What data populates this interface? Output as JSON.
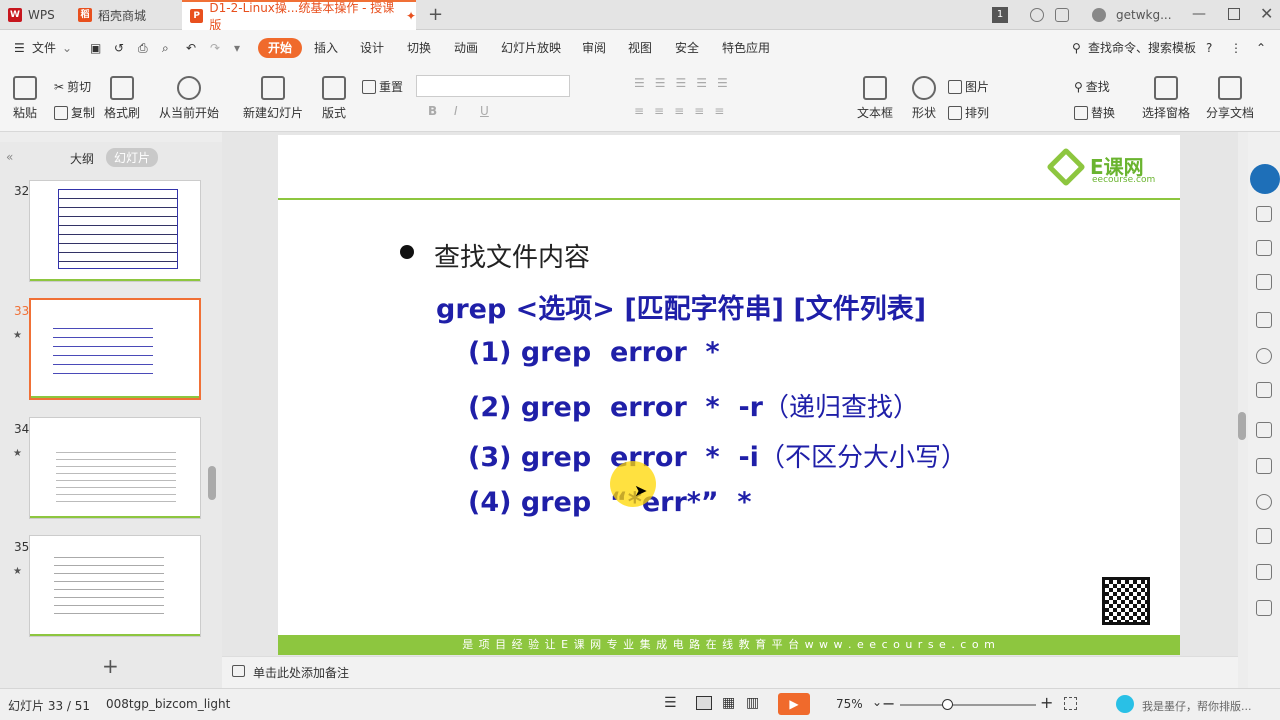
{
  "tabs": [
    {
      "label": "WPS",
      "color": "#c7161e"
    },
    {
      "label": "稻壳商城",
      "color": "#e8501e"
    },
    {
      "label": "D1-2-Linux操...统基本操作 - 授课版",
      "color": "#e8501e"
    }
  ],
  "titlebar": {
    "badge": "1",
    "user": "getwkg..."
  },
  "menu": {
    "file": "文件",
    "items": [
      "开始",
      "插入",
      "设计",
      "切换",
      "动画",
      "幻灯片放映",
      "审阅",
      "视图",
      "安全",
      "特色应用"
    ],
    "search": "查找命令、搜索模板"
  },
  "ribbon": {
    "paste": "粘贴",
    "cut": "剪切",
    "copy": "复制",
    "format_painter": "格式刷",
    "from_current": "从当前开始",
    "new_slide": "新建幻灯片",
    "layout": "版式",
    "reset": "重置",
    "textbox": "文本框",
    "shape": "形状",
    "picture": "图片",
    "arrange": "排列",
    "find": "查找",
    "replace": "替换",
    "select_pane": "选择窗格",
    "share": "分享文档"
  },
  "left_panel": {
    "outline_tab": "大纲",
    "slides_tab": "幻灯片",
    "slides": [
      {
        "num": "32"
      },
      {
        "num": "33"
      },
      {
        "num": "34"
      },
      {
        "num": "35"
      }
    ]
  },
  "slide": {
    "logo_text": "E课网",
    "logo_sub": "eecourse.com",
    "bullet_title": "查找文件内容",
    "syntax_cmd": "grep <选项> [匹配字符串] [文件列表]",
    "examples": [
      {
        "code": "(1) grep  error  *",
        "note": ""
      },
      {
        "code": "(2) grep  error  *  -r",
        "note": "（递归查找）"
      },
      {
        "code": "(3) grep  error  *  -i",
        "note": "（不区分大小写）"
      },
      {
        "code": "(4) grep  “*err*”  *",
        "note": ""
      }
    ],
    "footer": "是 项 目 经 验 让 E 课 网 专 业  集 成 电 路 在 线 教 育 平 台 w w w . e e c o u r s e . c o m"
  },
  "notes_placeholder": "单击此处添加备注",
  "status": {
    "slide_counter": "幻灯片 33 / 51",
    "theme": "008tgp_bizcom_light",
    "zoom": "75%",
    "assistant": "我是墨仔，帮你排版..."
  }
}
